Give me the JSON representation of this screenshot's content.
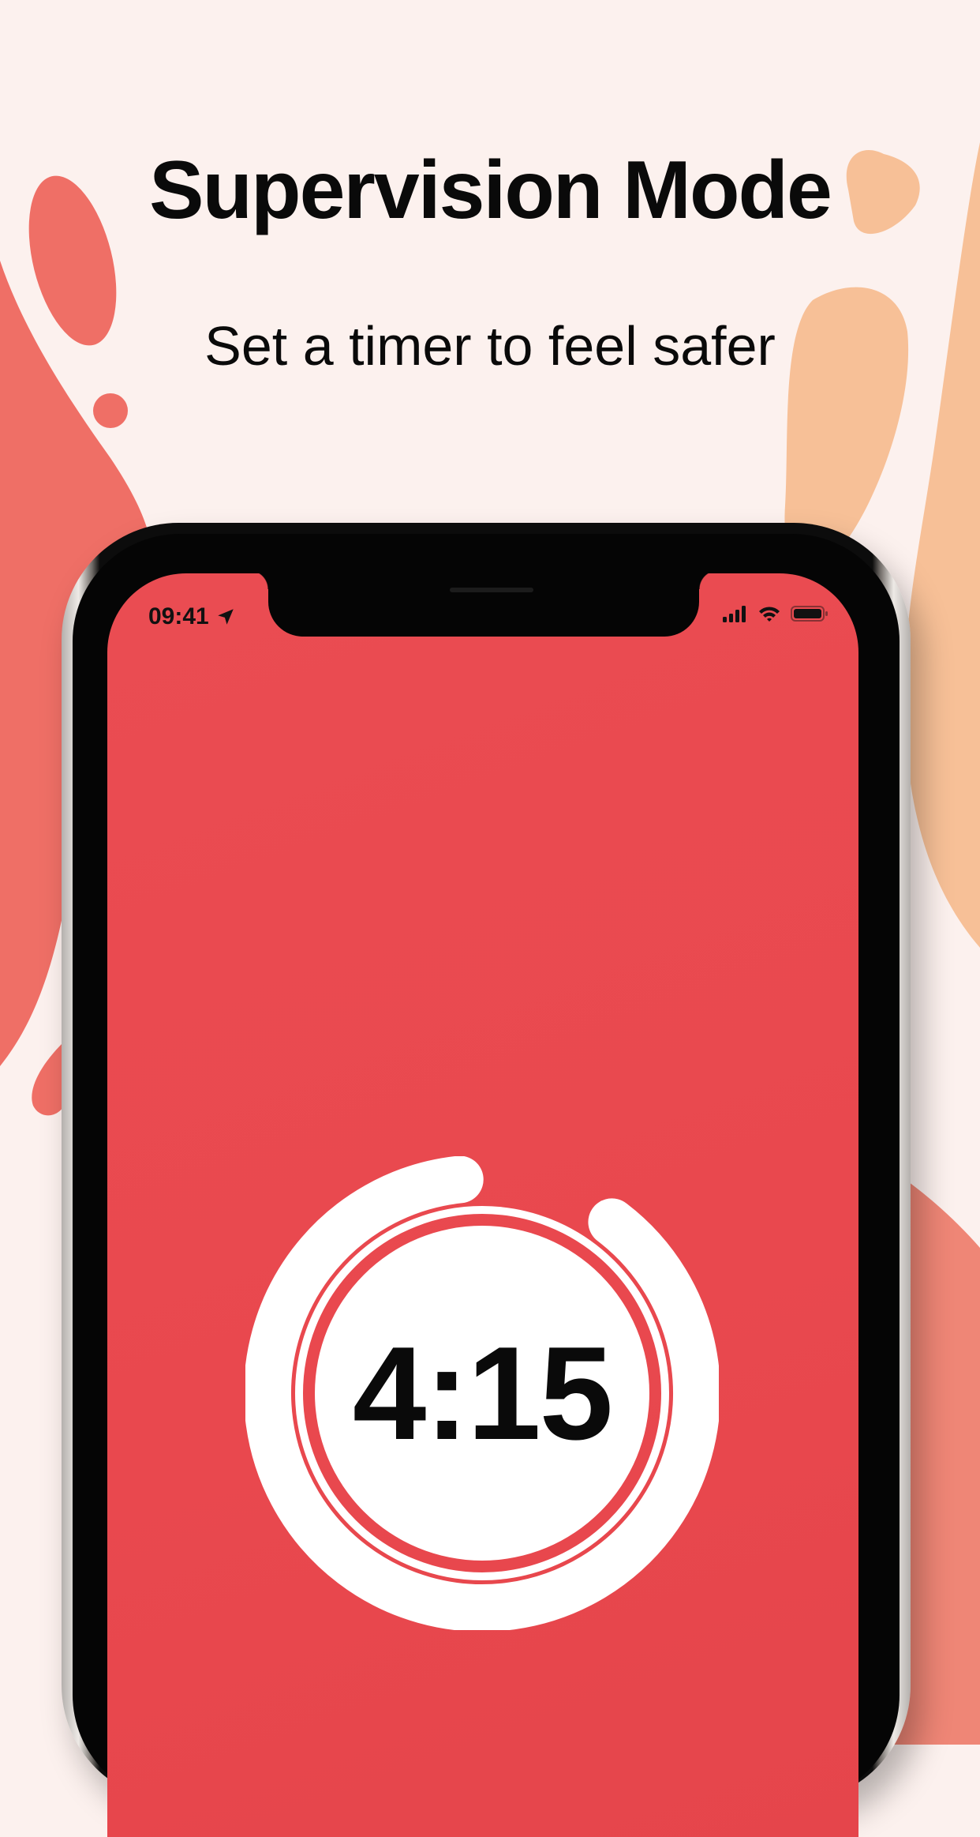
{
  "headline": {
    "title": "Supervision Mode",
    "subtitle": "Set a timer to feel safer"
  },
  "status_bar": {
    "time": "09:41",
    "icons": [
      "location-arrow-icon",
      "cellular-signal-icon",
      "wifi-icon",
      "battery-icon"
    ]
  },
  "timer": {
    "display": "4:15",
    "progress_fraction": 0.88
  },
  "colors": {
    "background": "#fcf1ee",
    "accent_red": "#e9494f",
    "blob_coral": "#ef6f66",
    "blob_peach": "#f7c097",
    "timer_ring": "#ffffff",
    "text": "#0a0a0a"
  }
}
